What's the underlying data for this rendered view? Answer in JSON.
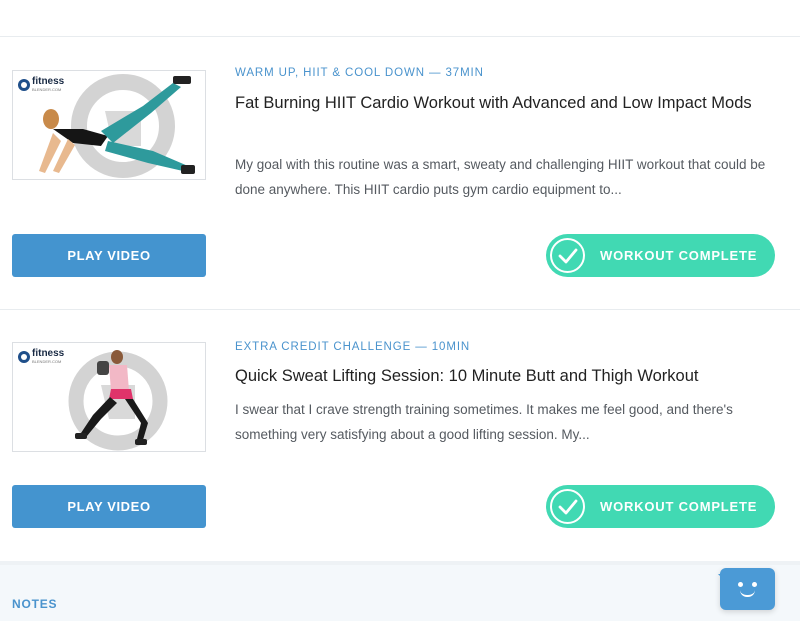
{
  "workouts": [
    {
      "category": "WARM UP, HIIT & COOL DOWN — 37MIN",
      "title": "Fat Burning HIIT Cardio Workout with Advanced and Low Impact Mods",
      "description": "My goal with this routine was a smart, sweaty and challenging HIIT workout that could be done anywhere. This HIIT cardio puts gym cardio equipment to...",
      "play_label": "PLAY VIDEO",
      "complete_label": "WORKOUT COMPLETE",
      "thumbnail_logo": "fitness",
      "thumbnail_logo_sub": "BLENDER.COM"
    },
    {
      "category": "EXTRA CREDIT CHALLENGE — 10MIN",
      "title": "Quick Sweat Lifting Session: 10 Minute Butt and Thigh Workout",
      "description": "I swear that I crave strength training sometimes. It makes me feel good, and there's something very satisfying about a good lifting session. My...",
      "play_label": "PLAY VIDEO",
      "complete_label": "WORKOUT COMPLETE",
      "thumbnail_logo": "fitness",
      "thumbnail_logo_sub": "BLENDER.COM"
    }
  ],
  "notes": {
    "label": "NOTES"
  },
  "colors": {
    "accent_blue": "#4494cf",
    "complete_green": "#41d9b3",
    "category_blue": "#4a93cd"
  },
  "icons": {
    "check": "check-icon",
    "chat": "chat-widget-icon"
  }
}
